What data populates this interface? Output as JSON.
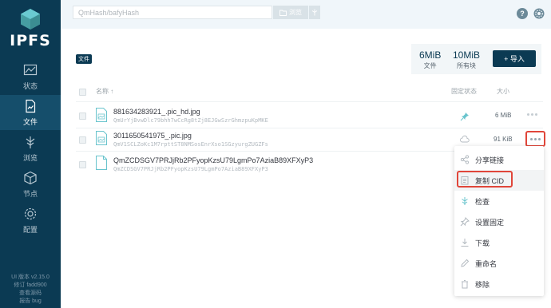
{
  "app": {
    "brand": "IPFS",
    "nav": [
      {
        "key": "status",
        "label": "状态",
        "icon": "status-chart-icon"
      },
      {
        "key": "files",
        "label": "文件",
        "icon": "files-icon",
        "active": true
      },
      {
        "key": "explore",
        "label": "浏览",
        "icon": "explore-tree-icon"
      },
      {
        "key": "peers",
        "label": "节点",
        "icon": "peers-cube-icon"
      },
      {
        "key": "settings",
        "label": "配置",
        "icon": "settings-gear-icon"
      }
    ],
    "footer": [
      "UI 版本 v2.15.0",
      "修订 fadd900",
      "查看源码",
      "报告 bug"
    ]
  },
  "topbar": {
    "search_placeholder": "QmHash/bafyHash",
    "browse_label": "浏览"
  },
  "files": {
    "badge": "文件",
    "stats": [
      {
        "value": "6MiB",
        "label": "文件"
      },
      {
        "value": "10MiB",
        "label": "所有块"
      }
    ],
    "import_label": "+ 导入",
    "headers": {
      "name": "名称 ↑",
      "pin": "固定状态",
      "size": "大小"
    },
    "rows": [
      {
        "name": "881634283921_.pic_hd.jpg",
        "hash": "QmUrYjBvwDlc79bhh7wCcRg8tZj8EJGwSzrGhmzpuKpMKE",
        "size": "6 MiB"
      },
      {
        "name": "3011650541975_.pic.jpg",
        "hash": "QmV1SCLZoKc1M7rpttST8NMSosEnrXso1SGzyurgZUGZFs",
        "size": "91 KiB"
      },
      {
        "name": "QmZCDSGV7PRJjRb2PFyopKzsU79LgmPo7AziaB89XFXyP3",
        "hash": "QmZCDSGV7PRJjRb2PFyopKzsU79LgmPo7AziaB89XFXyP3",
        "size": ""
      }
    ]
  },
  "context_menu": {
    "items": [
      {
        "label": "分享链接",
        "icon": "share-icon"
      },
      {
        "label": "复制 CID",
        "icon": "copy-icon"
      },
      {
        "label": "检查",
        "icon": "inspect-icon"
      },
      {
        "label": "设置固定",
        "icon": "pin-icon"
      },
      {
        "label": "下载",
        "icon": "download-icon"
      },
      {
        "label": "重命名",
        "icon": "rename-pencil-icon"
      },
      {
        "label": "移除",
        "icon": "trash-icon"
      }
    ]
  },
  "colors": {
    "sidebar": "#0b3a53",
    "accent_red": "#e0463a",
    "teal": "#69c4cd"
  }
}
